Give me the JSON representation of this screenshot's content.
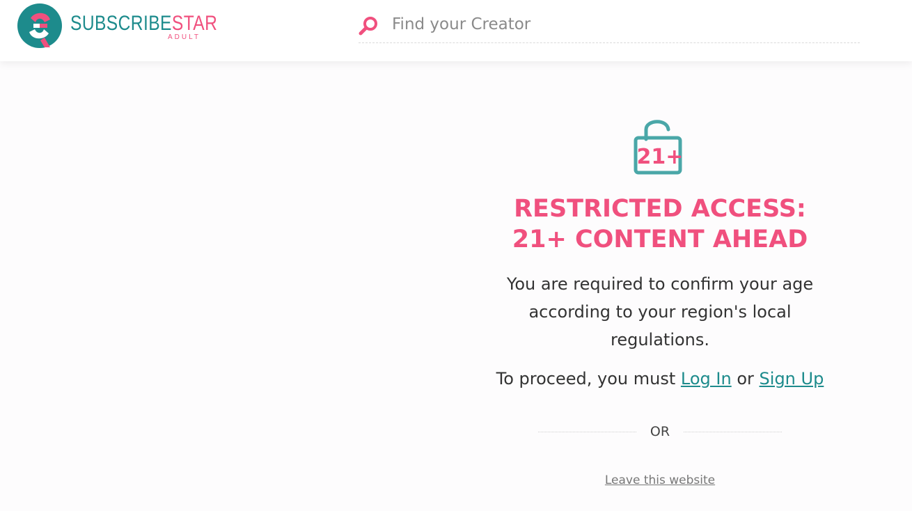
{
  "header": {
    "logo": {
      "word_primary": "SUBSCRIBE",
      "word_accent": "STAR",
      "subtitle": "ADULT"
    },
    "search": {
      "placeholder": "Find your Creator"
    }
  },
  "gate": {
    "badge_text": "21+",
    "headline_line1": "RESTRICTED ACCESS:",
    "headline_line2": "21+ CONTENT AHEAD",
    "description": "You are required to confirm your age according to your region's local regulations.",
    "proceed_prefix": "To proceed, you must",
    "login_label": "Log In",
    "or_word": "or",
    "signup_label": "Sign Up",
    "divider_label": "OR",
    "leave_label": "Leave this website"
  },
  "colors": {
    "brand_teal": "#1d8b8c",
    "brand_pink": "#f0507e",
    "lock_teal": "#4aa7a8"
  }
}
